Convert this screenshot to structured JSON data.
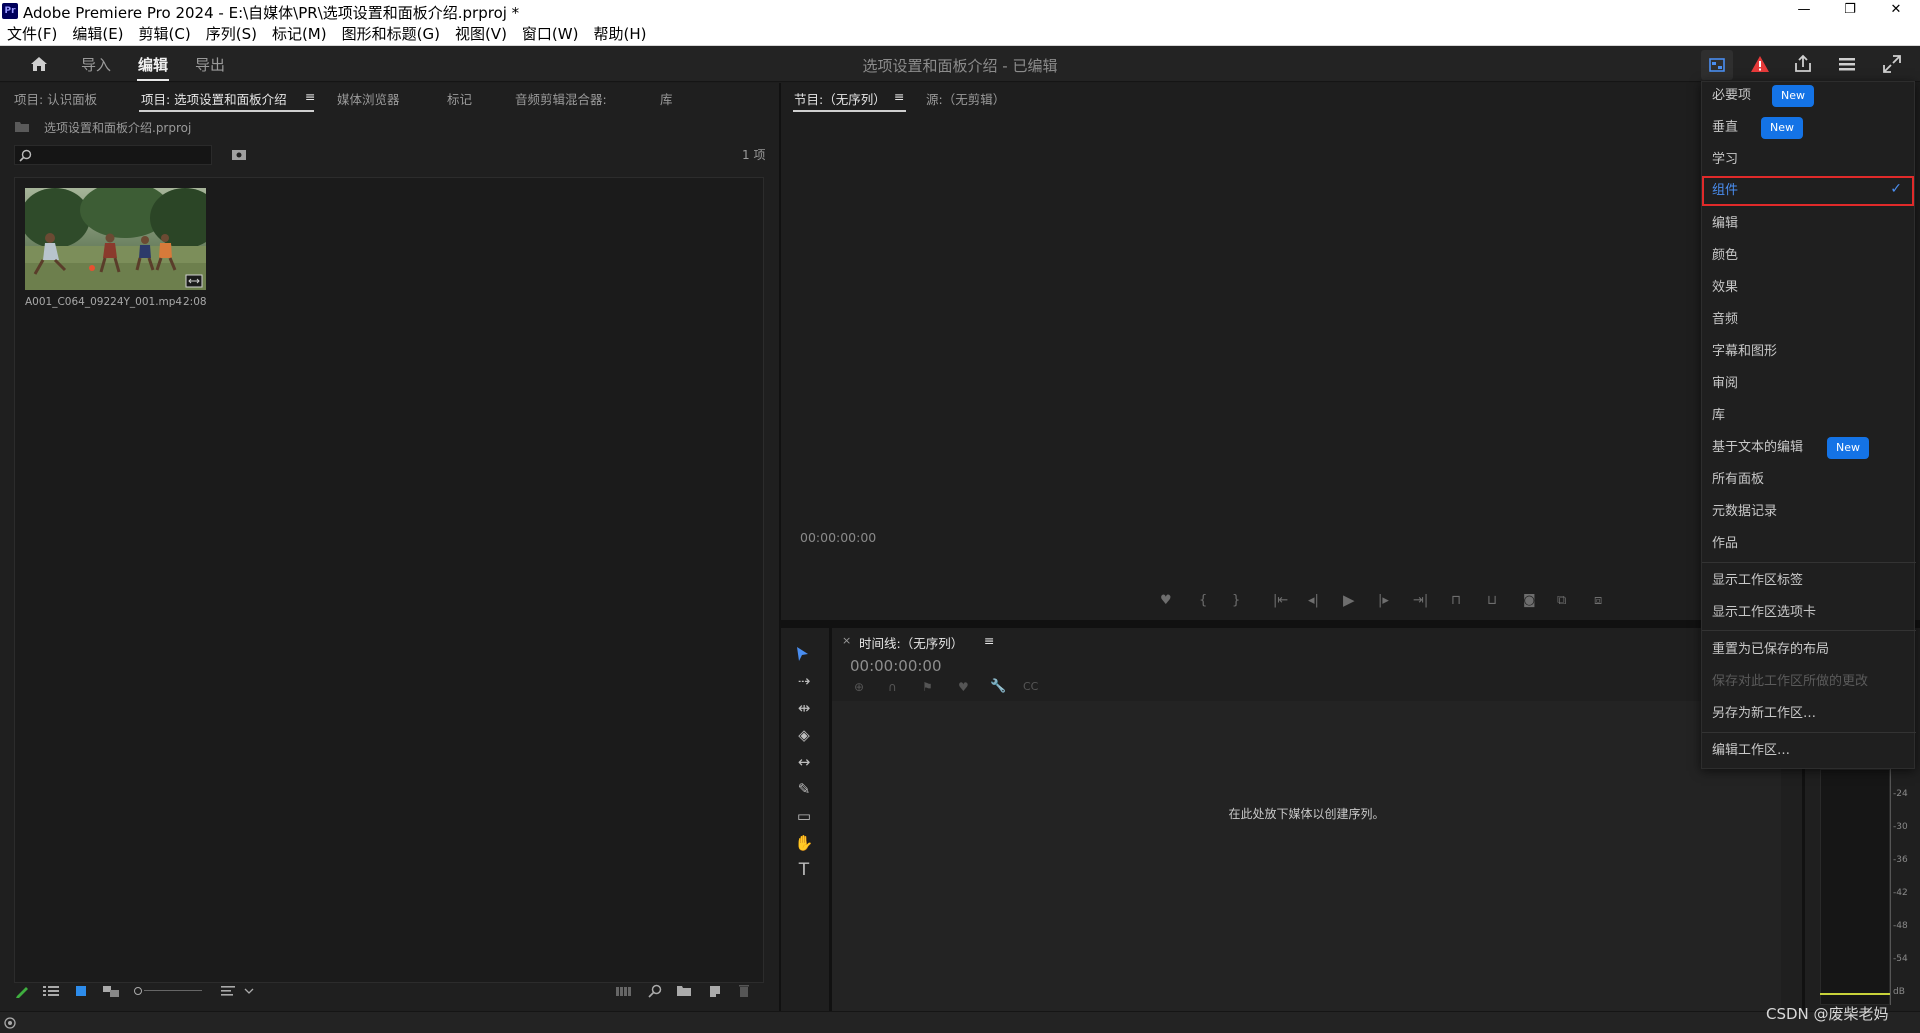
{
  "window": {
    "app_icon": "Pr",
    "title": "Adobe Premiere Pro 2024 - E:\\自媒体\\PR\\选项设置和面板介绍.prproj *",
    "minimize": "—",
    "maximize": "❐",
    "close": "✕"
  },
  "menubar": {
    "items": [
      "文件(F)",
      "编辑(E)",
      "剪辑(C)",
      "序列(S)",
      "标记(M)",
      "图形和标题(G)",
      "视图(V)",
      "窗口(W)",
      "帮助(H)"
    ]
  },
  "header": {
    "tabs": [
      "导入",
      "编辑",
      "导出"
    ],
    "active_tab": "编辑",
    "document_title": "选项设置和面板介绍 - 已编辑"
  },
  "project_panel": {
    "tabs": [
      "项目: 认识面板",
      "项目: 选项设置和面板介绍",
      "媒体浏览器",
      "标记",
      "音频剪辑混合器:",
      "库"
    ],
    "active_tab_menu": "≡",
    "project_file": "选项设置和面板介绍.prproj",
    "item_count": "1 项",
    "clip": {
      "name": "A001_C064_09224Y_001.mp4",
      "duration": "2:08"
    }
  },
  "program_monitor": {
    "tabs": [
      "节目:（无序列）",
      "源:（无剪辑）"
    ],
    "menu": "≡",
    "timecode": "00:00:00:00"
  },
  "timeline": {
    "close": "×",
    "title": "时间线:（无序列）",
    "menu": "≡",
    "timecode": "00:00:00:00",
    "empty_message": "在此处放下媒体以创建序列。"
  },
  "workspace_menu": {
    "items": [
      {
        "label": "必要项",
        "badge": "New"
      },
      {
        "label": "垂直",
        "badge": "New"
      },
      {
        "label": "学习"
      },
      {
        "label": "组件",
        "checked": "✓"
      },
      {
        "label": "编辑"
      },
      {
        "label": "颜色"
      },
      {
        "label": "效果"
      },
      {
        "label": "音频"
      },
      {
        "label": "字幕和图形"
      },
      {
        "label": "审阅"
      },
      {
        "label": "库"
      },
      {
        "label": "基于文本的编辑",
        "badge": "New"
      },
      {
        "label": "所有面板"
      },
      {
        "label": "元数据记录"
      },
      {
        "label": "作品"
      }
    ],
    "show_labels": "显示工作区标签",
    "show_tabs": "显示工作区选项卡",
    "reset": "重置为已保存的布局",
    "save_changes": "保存对此工作区所做的更改",
    "save_as": "另存为新工作区…",
    "edit": "编辑工作区…"
  },
  "audio_meter": {
    "labels": [
      "-24",
      "-30",
      "-36",
      "-42",
      "-48",
      "-54",
      "dB"
    ]
  },
  "watermark": "CSDN @废柴老妈",
  "colors": {
    "accent": "#1473e6",
    "highlight_border": "#e02a2a",
    "warning": "#e63a3a",
    "tool_active": "#4a8ef0"
  }
}
